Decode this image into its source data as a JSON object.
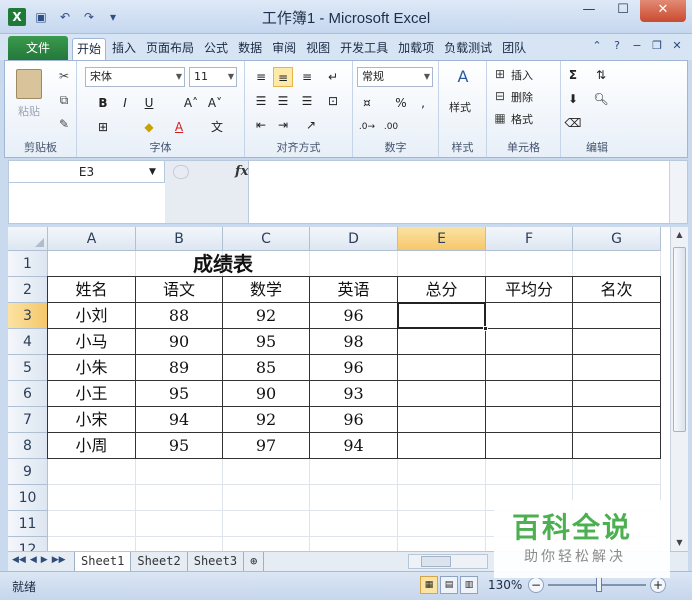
{
  "window": {
    "title": "工作簿1 - Microsoft Excel",
    "app_icon": "excel-icon",
    "controls": [
      "minimize-icon",
      "maximize-icon",
      "close-icon"
    ]
  },
  "quick_access": [
    "save-icon",
    "undo-icon",
    "redo-icon",
    "customize-icon"
  ],
  "ribbon": {
    "file_tab": "文件",
    "tabs": [
      "开始",
      "插入",
      "页面布局",
      "公式",
      "数据",
      "审阅",
      "视图",
      "开发工具",
      "加载项",
      "负载测试",
      "团队"
    ],
    "active_tab": "开始",
    "groups": {
      "clipboard": {
        "label": "剪贴板",
        "paste": "粘贴"
      },
      "font": {
        "label": "字体",
        "font_name": "宋体",
        "font_size": "11",
        "bold": "B",
        "italic": "I",
        "underline": "U"
      },
      "alignment": {
        "label": "对齐方式"
      },
      "number": {
        "label": "数字",
        "format": "常规",
        "percent": "%",
        "comma": ","
      },
      "styles": {
        "label": "样式",
        "button": "样式"
      },
      "cells": {
        "label": "单元格",
        "insert": "插入",
        "delete": "删除",
        "format": "格式"
      },
      "editing": {
        "label": "编辑",
        "sum": "Σ"
      }
    }
  },
  "formula_bar": {
    "name_box": "E3",
    "fx": "fx",
    "content": ""
  },
  "sheet": {
    "columns": [
      "A",
      "B",
      "C",
      "D",
      "E",
      "F",
      "G"
    ],
    "selected_column": "E",
    "rows": [
      "1",
      "2",
      "3",
      "4",
      "5",
      "6",
      "7",
      "8",
      "9",
      "10",
      "11",
      "12"
    ],
    "selected_row": "3",
    "title": "成绩表",
    "headers": [
      "姓名",
      "语文",
      "数学",
      "英语",
      "总分",
      "平均分",
      "名次"
    ],
    "records": [
      [
        "小刘",
        "88",
        "92",
        "96",
        "",
        "",
        ""
      ],
      [
        "小马",
        "90",
        "95",
        "98",
        "",
        "",
        ""
      ],
      [
        "小朱",
        "89",
        "85",
        "96",
        "",
        "",
        ""
      ],
      [
        "小王",
        "95",
        "90",
        "93",
        "",
        "",
        ""
      ],
      [
        "小宋",
        "94",
        "92",
        "96",
        "",
        "",
        ""
      ],
      [
        "小周",
        "95",
        "97",
        "94",
        "",
        "",
        ""
      ]
    ]
  },
  "sheet_tabs": [
    "Sheet1",
    "Sheet2",
    "Sheet3"
  ],
  "active_sheet": "Sheet1",
  "status": {
    "ready": "就绪",
    "zoom": "130%"
  },
  "watermark": {
    "title": "百科全说",
    "subtitle": "助你轻松解决"
  }
}
